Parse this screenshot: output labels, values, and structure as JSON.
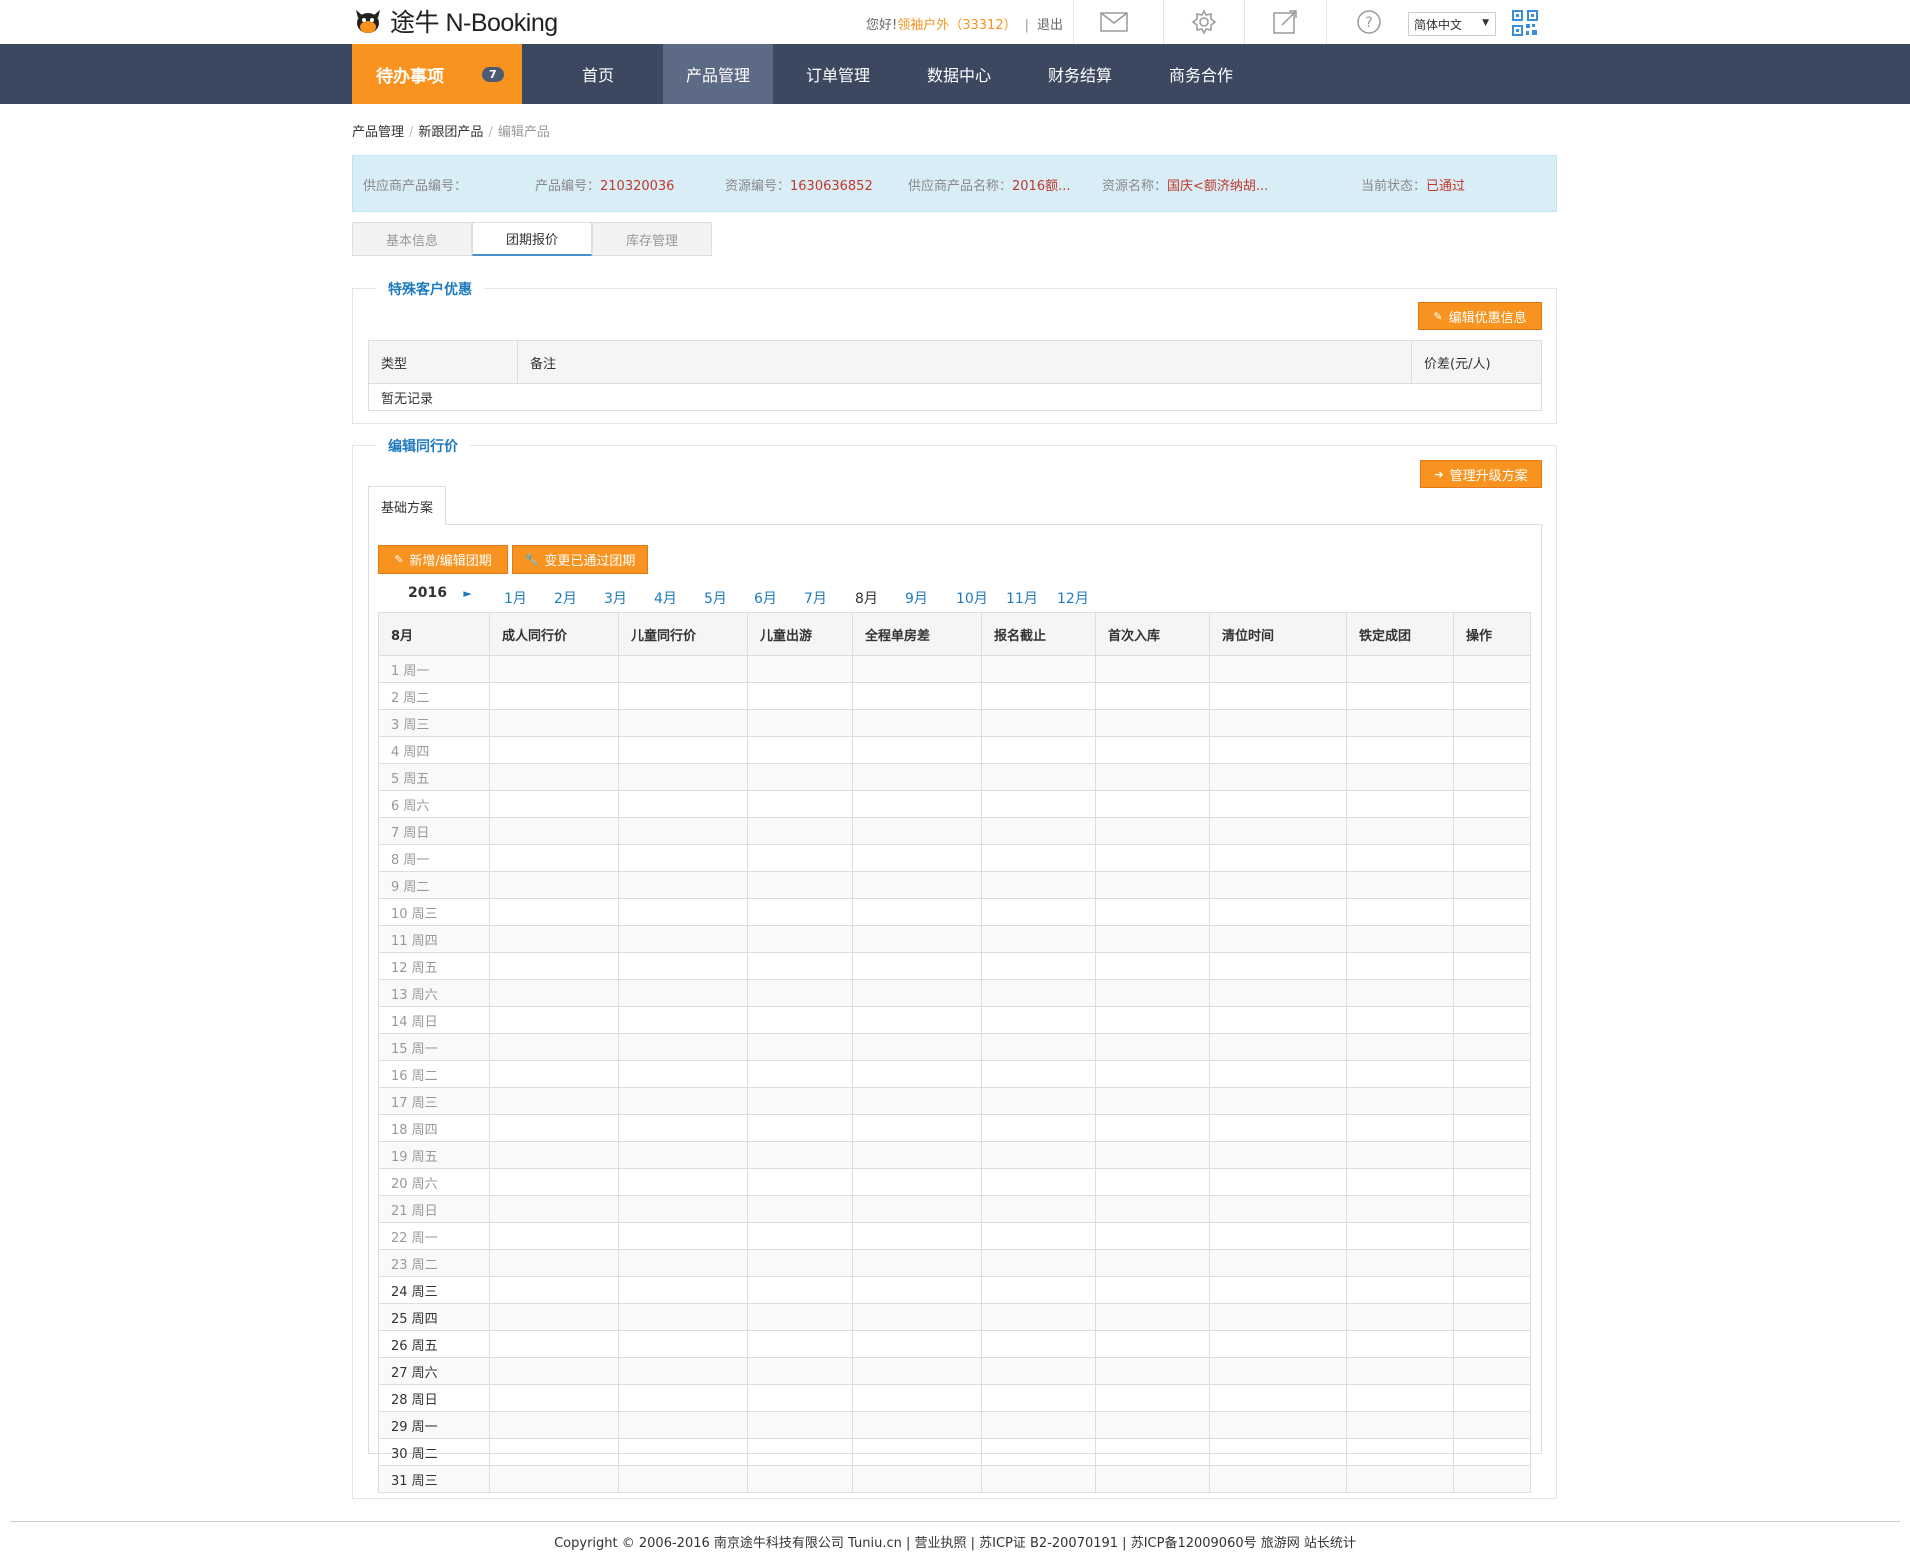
{
  "brand": {
    "logo_text": "途牛 N-Booking"
  },
  "header": {
    "greeting_prefix": "您好!",
    "user": "领袖户外",
    "user_id": "（33312）",
    "separator": "|",
    "logout": "退出",
    "icons": [
      "mail-icon",
      "settings-icon",
      "external-link-icon",
      "help-icon"
    ],
    "language": "简体中文",
    "qr_icon": "qr-code-icon"
  },
  "nav": {
    "todo_label": "待办事项",
    "todo_count": "7",
    "items": [
      "首页",
      "产品管理",
      "订单管理",
      "数据中心",
      "财务结算",
      "商务合作"
    ],
    "active": "产品管理"
  },
  "breadcrumb": [
    "产品管理",
    "新跟团产品",
    "编辑产品"
  ],
  "info": {
    "supplier_no_label": "供应商产品编号：",
    "product_no_label": "产品编号：",
    "product_no": "210320036",
    "resource_no_label": "资源编号：",
    "resource_no": "1630636852",
    "supplier_name_label": "供应商产品名称：",
    "supplier_name": "2016额...",
    "resource_name_label": "资源名称：",
    "resource_name": "国庆<额济纳胡...",
    "status_label": "当前状态：",
    "status": "已通过"
  },
  "tabs": [
    "基本信息",
    "团期报价",
    "库存管理"
  ],
  "special": {
    "legend": "特殊客户优惠",
    "edit_button": "编辑优惠信息",
    "columns": [
      "类型",
      "备注",
      "价差(元/人)"
    ],
    "empty": "暂无记录"
  },
  "peer": {
    "legend": "编辑同行价",
    "manage_button": "管理升级方案",
    "subtab": "基础方案",
    "add_button": "新增/编辑团期",
    "change_button": "变更已通过团期",
    "year": "2016",
    "year_arrow": "►",
    "months": [
      "1月",
      "2月",
      "3月",
      "4月",
      "5月",
      "6月",
      "7月",
      "8月",
      "9月",
      "10月",
      "11月",
      "12月"
    ],
    "current_month": "8月",
    "columns": [
      "8月",
      "成人同行价",
      "儿童同行价",
      "儿童出游",
      "全程单房差",
      "报名截止",
      "首次入库",
      "清位时间",
      "铁定成团",
      "操作"
    ],
    "days": [
      "1 周一",
      "2 周二",
      "3 周三",
      "4 周四",
      "5 周五",
      "6 周六",
      "7 周日",
      "8 周一",
      "9 周二",
      "10 周三",
      "11 周四",
      "12 周五",
      "13 周六",
      "14 周日",
      "15 周一",
      "16 周二",
      "17 周三",
      "18 周四",
      "19 周五",
      "20 周六",
      "21 周日",
      "22 周一",
      "23 周二",
      "24 周三",
      "25 周四",
      "26 周五",
      "27 周六",
      "28 周日",
      "29 周一",
      "30 周二",
      "31 周三"
    ],
    "first_future_day": 24
  },
  "footer": "Copyright © 2006-2016 南京途牛科技有限公司 Tuniu.cn | 营业执照 | 苏ICP证 B2-20070191 | 苏ICP备12009060号 旅游网 站长统计"
}
